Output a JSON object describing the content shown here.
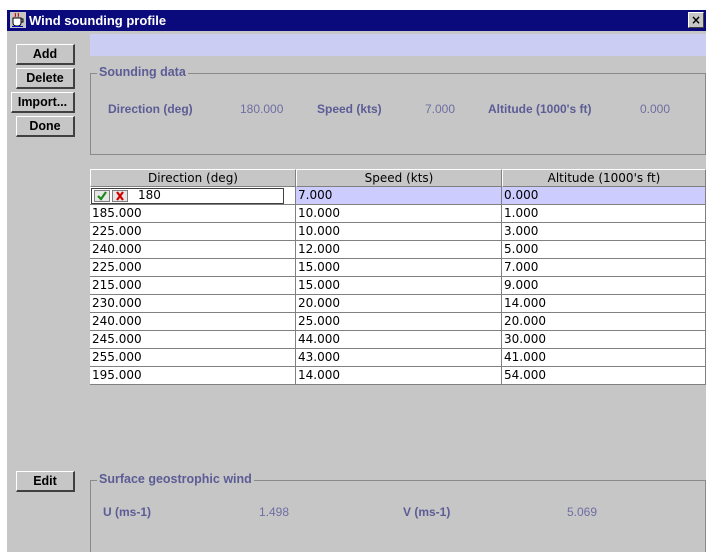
{
  "window": {
    "title": "Wind sounding profile",
    "close_label": "×"
  },
  "buttons": {
    "add": "Add",
    "delete": "Delete",
    "import": "Import...",
    "done": "Done",
    "edit": "Edit"
  },
  "sounding": {
    "legend": "Sounding data",
    "direction_label": "Direction (deg)",
    "direction_value": "180.000",
    "speed_label": "Speed (kts)",
    "speed_value": "7.000",
    "altitude_label": "Altitude (1000's ft)",
    "altitude_value": "0.000"
  },
  "table": {
    "columns": [
      "Direction (deg)",
      "Speed (kts)",
      "Altitude (1000's ft)"
    ],
    "editing_value": "180",
    "rows": [
      [
        "",
        "7.000",
        "0.000"
      ],
      [
        "185.000",
        "10.000",
        "1.000"
      ],
      [
        "225.000",
        "10.000",
        "3.000"
      ],
      [
        "240.000",
        "12.000",
        "5.000"
      ],
      [
        "225.000",
        "15.000",
        "7.000"
      ],
      [
        "215.000",
        "15.000",
        "9.000"
      ],
      [
        "230.000",
        "20.000",
        "14.000"
      ],
      [
        "240.000",
        "25.000",
        "20.000"
      ],
      [
        "245.000",
        "44.000",
        "30.000"
      ],
      [
        "255.000",
        "43.000",
        "41.000"
      ],
      [
        "195.000",
        "14.000",
        "54.000"
      ]
    ]
  },
  "surface": {
    "legend": "Surface geostrophic wind",
    "u_label": "U (ms-1)",
    "u_value": "1.498",
    "v_label": "V (ms-1)",
    "v_value": "5.069"
  },
  "icons": {
    "app": "coffee-cup-icon",
    "accept": "checkmark-icon",
    "cancel": "x-icon",
    "close": "close-icon"
  },
  "colors": {
    "titlebar": "#0a0a7c",
    "selection": "#ccccff",
    "label_text": "#5c5c96"
  }
}
